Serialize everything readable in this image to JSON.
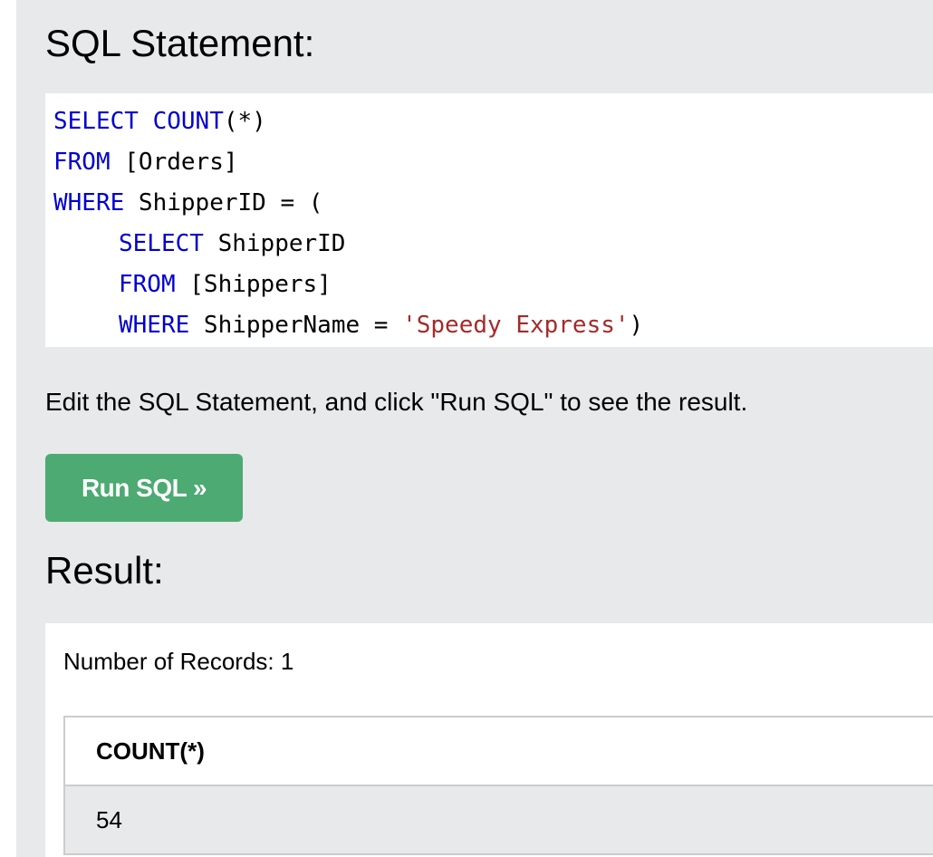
{
  "sql_section": {
    "title": "SQL Statement:",
    "code": {
      "line1": {
        "kw1": "SELECT",
        "kw2": "COUNT",
        "rest": "(*)"
      },
      "line2": {
        "kw": "FROM",
        "rest": " [Orders]"
      },
      "line3": {
        "kw": "WHERE",
        "rest": " ShipperID = ("
      },
      "line4": {
        "kw": "SELECT",
        "rest": " ShipperID"
      },
      "line5": {
        "kw": "FROM",
        "rest": " [Shippers]"
      },
      "line6": {
        "kw": "WHERE",
        "mid": " ShipperName = ",
        "str": "'Speedy Express'",
        "rest": ")"
      }
    },
    "instruction": "Edit the SQL Statement, and click \"Run SQL\" to see the result.",
    "run_button_label": "Run SQL »"
  },
  "result_section": {
    "title": "Result:",
    "records_label": "Number of Records: 1",
    "table": {
      "columns": [
        "COUNT(*)"
      ],
      "rows": [
        [
          "54"
        ]
      ]
    }
  },
  "colors": {
    "keyword": "#0000cd",
    "string": "#a52a2a",
    "button": "#4caa72",
    "panel": "#e7e9eb"
  }
}
